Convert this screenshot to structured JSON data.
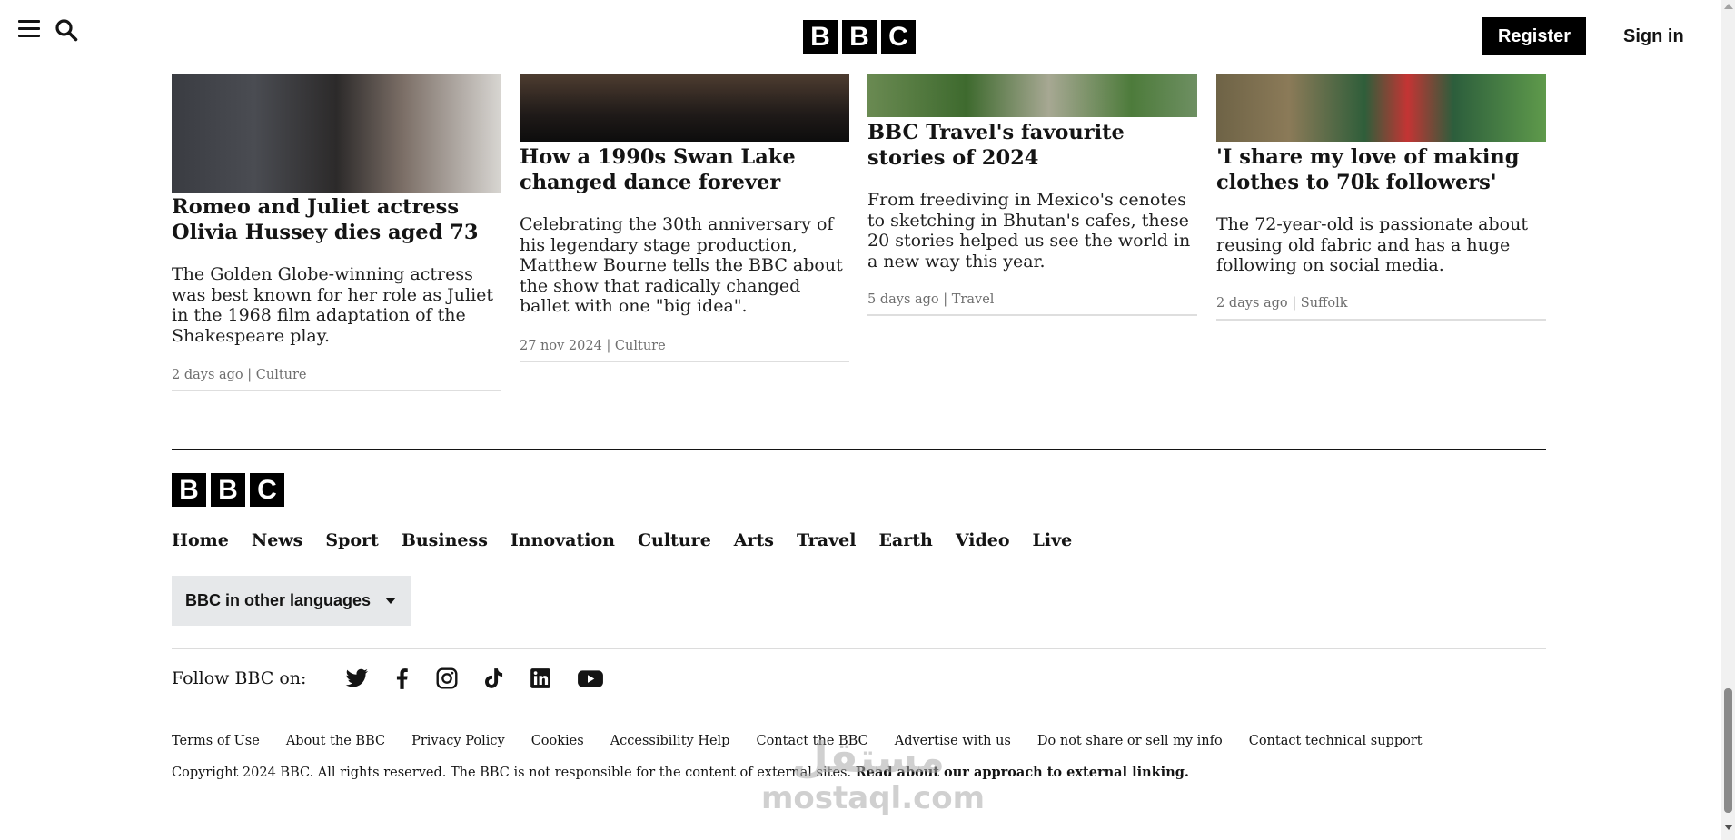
{
  "header": {
    "menu_icon": "hamburger-menu-icon",
    "search_icon": "search-icon",
    "logo_letters": [
      "B",
      "B",
      "C"
    ],
    "register_label": "Register",
    "signin_label": "Sign in"
  },
  "articles": [
    {
      "title": "Romeo and Juliet actress Olivia Hussey dies aged 73",
      "summary": "The Golden Globe-winning actress was best known for her role as Juliet in the 1968 film adaptation of the Shakespeare play.",
      "date": "2 days ago",
      "section": "Culture",
      "meta": "2 days ago | Culture"
    },
    {
      "title": "How a 1990s Swan Lake changed dance forever",
      "summary": "Celebrating the 30th anniversary of his legendary stage production, Matthew Bourne tells the BBC about the show that radically changed ballet with one \"big idea\".",
      "date": "27 nov 2024",
      "section": "Culture",
      "meta": "27 nov 2024 | Culture"
    },
    {
      "title": "BBC Travel's favourite stories of 2024",
      "summary": "From freediving in Mexico's cenotes to sketching in Bhutan's cafes, these 20 stories helped us see the world in a new way this year.",
      "date": "5 days ago",
      "section": "Travel",
      "meta": "5 days ago | Travel"
    },
    {
      "title": "'I share my love of making clothes to 70k followers'",
      "summary": "The 72-year-old is passionate about reusing old fabric and has a huge following on social media.",
      "date": "2 days ago",
      "section": "Suffolk",
      "meta": "2 days ago | Suffolk"
    }
  ],
  "footer": {
    "logo_letters": [
      "B",
      "B",
      "C"
    ],
    "nav": [
      "Home",
      "News",
      "Sport",
      "Business",
      "Innovation",
      "Culture",
      "Arts",
      "Travel",
      "Earth",
      "Video",
      "Live"
    ],
    "languages_button": "BBC in other languages",
    "follow_label": "Follow BBC on:",
    "social_icons": [
      "twitter-icon",
      "facebook-icon",
      "instagram-icon",
      "tiktok-icon",
      "linkedin-icon",
      "youtube-icon"
    ],
    "legal_links": [
      "Terms of Use",
      "About the BBC",
      "Privacy Policy",
      "Cookies",
      "Accessibility Help",
      "Contact the BBC",
      "Advertise with us",
      "Do not share or sell my info",
      "Contact technical support"
    ],
    "copyright_text": "Copyright 2024 BBC. All rights reserved. The BBC is not responsible for the content of external sites.",
    "copyright_link": "Read about our approach to external linking."
  },
  "watermark": {
    "arabic": "مستقل",
    "latin": "mostaql.com"
  }
}
